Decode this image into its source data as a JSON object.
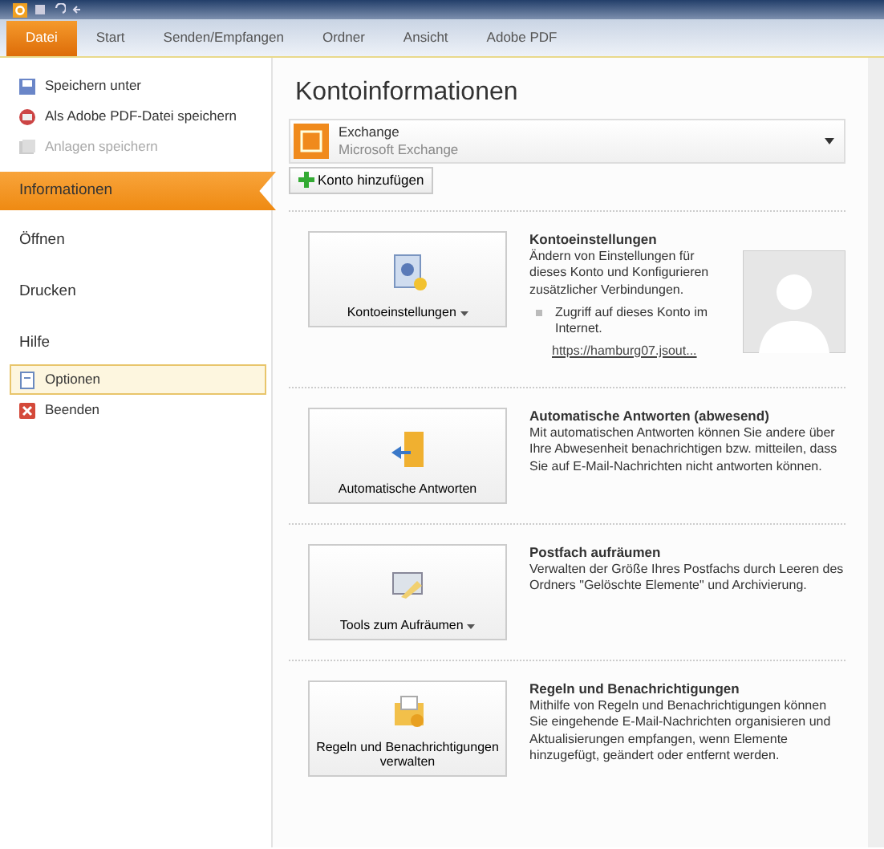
{
  "tabs": [
    {
      "label": "Datei",
      "selected": true
    },
    {
      "label": "Start",
      "selected": false
    },
    {
      "label": "Senden/Empfangen",
      "selected": false
    },
    {
      "label": "Ordner",
      "selected": false
    },
    {
      "label": "Ansicht",
      "selected": false
    },
    {
      "label": "Adobe PDF",
      "selected": false
    }
  ],
  "sidebar": {
    "items": [
      {
        "kind": "command",
        "label": "Speichern unter",
        "disabled": false,
        "selected": false
      },
      {
        "kind": "command",
        "label": "Als Adobe PDF-Datei speichern",
        "disabled": false,
        "selected": false
      },
      {
        "kind": "command",
        "label": "Anlagen speichern",
        "disabled": true,
        "selected": false
      },
      {
        "kind": "nav",
        "label": "Informationen",
        "selected": true
      },
      {
        "kind": "nav",
        "label": "Öffnen",
        "selected": false
      },
      {
        "kind": "nav",
        "label": "Drucken",
        "selected": false
      },
      {
        "kind": "nav",
        "label": "Hilfe",
        "selected": false
      },
      {
        "kind": "command",
        "label": "Optionen",
        "disabled": false,
        "selected": true
      },
      {
        "kind": "command",
        "label": "Beenden",
        "disabled": false,
        "selected": false
      }
    ]
  },
  "main": {
    "title": "Kontoinformationen",
    "account": {
      "name": "Exchange",
      "type": "Microsoft Exchange"
    },
    "add_button": "Konto hinzufügen",
    "sections": [
      {
        "button": {
          "label": "Kontoeinstellungen",
          "dropdown": true
        },
        "title": "Kontoeinstellungen",
        "description": "Ändern von Einstellungen für dieses Konto und Konfigurieren zusätzlicher Verbindungen.",
        "bullet": "Zugriff auf dieses Konto im Internet.",
        "link": "https://hamburg07.jsout...",
        "avatar": true
      },
      {
        "button": {
          "label": "Automatische Antworten",
          "dropdown": false
        },
        "title": "Automatische Antworten (abwesend)",
        "description": "Mit automatischen Antworten können Sie andere über Ihre Abwesenheit benachrichtigen bzw. mitteilen, dass Sie auf E-Mail-Nachrichten nicht antworten können.",
        "avatar": false
      },
      {
        "button": {
          "label": "Tools zum Aufräumen",
          "dropdown": true
        },
        "title": "Postfach aufräumen",
        "description": "Verwalten der Größe Ihres Postfachs durch Leeren des Ordners \"Gelöschte Elemente\" und Archivierung.",
        "avatar": false
      },
      {
        "button": {
          "label": "Regeln und Benachrichtigungen verwalten",
          "dropdown": false
        },
        "title": "Regeln und Benachrichtigungen",
        "description": "Mithilfe von Regeln und Benachrichtigungen können Sie eingehende E-Mail-Nachrichten organisieren und Aktualisierungen empfangen, wenn Elemente hinzugefügt, geändert oder entfernt werden.",
        "avatar": false
      }
    ]
  }
}
